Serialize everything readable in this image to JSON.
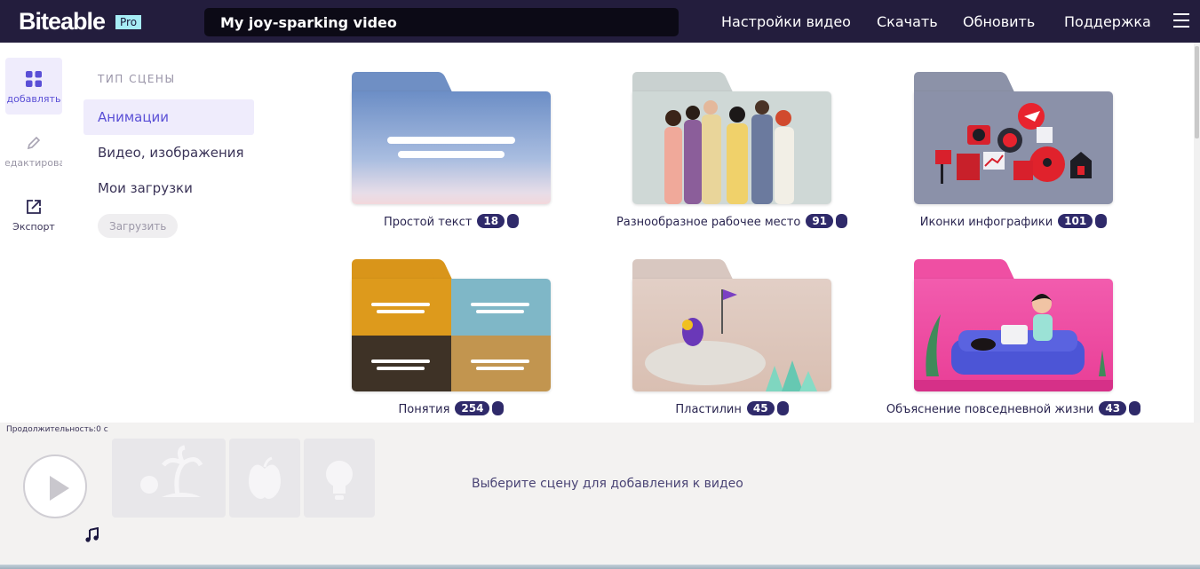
{
  "header": {
    "logo": "Biteable",
    "pro_badge": "Pro",
    "video_title": "My joy-sparking video",
    "nav": [
      "Настройки видео",
      "Скачать",
      "Обновить",
      "Поддержка"
    ]
  },
  "rail": {
    "items": [
      {
        "label": "добавлять",
        "icon": "grid-icon",
        "active": true
      },
      {
        "label": "редактировать",
        "icon": "pencil-icon",
        "active": false
      },
      {
        "label": "Экспорт",
        "icon": "export-icon",
        "active": false
      }
    ]
  },
  "panel": {
    "heading": "ТИП СЦЕНЫ",
    "items": [
      {
        "label": "Анимации",
        "active": true
      },
      {
        "label": "Видео, изображения",
        "active": false
      },
      {
        "label": "Мои загрузки",
        "active": false
      }
    ],
    "upload_label": "Загрузить"
  },
  "scenes": [
    {
      "label": "Простой текст",
      "count": "18"
    },
    {
      "label": "Разнообразное рабочее место",
      "count": "91"
    },
    {
      "label": "Иконки инфографики",
      "count": "101"
    },
    {
      "label": "Понятия",
      "count": "254"
    },
    {
      "label": "Пластилин",
      "count": "45"
    },
    {
      "label": "Объяснение повседневной жизни",
      "count": "43"
    }
  ],
  "timeline": {
    "duration": "Продолжительность:0 с",
    "hint": "Выберите сцену для добавления к видео"
  },
  "colors": {
    "header_bg": "#231d3d",
    "accent": "#5a4fd6",
    "badge": "#2f2a6a",
    "pro_badge": "#a6ecf5"
  }
}
